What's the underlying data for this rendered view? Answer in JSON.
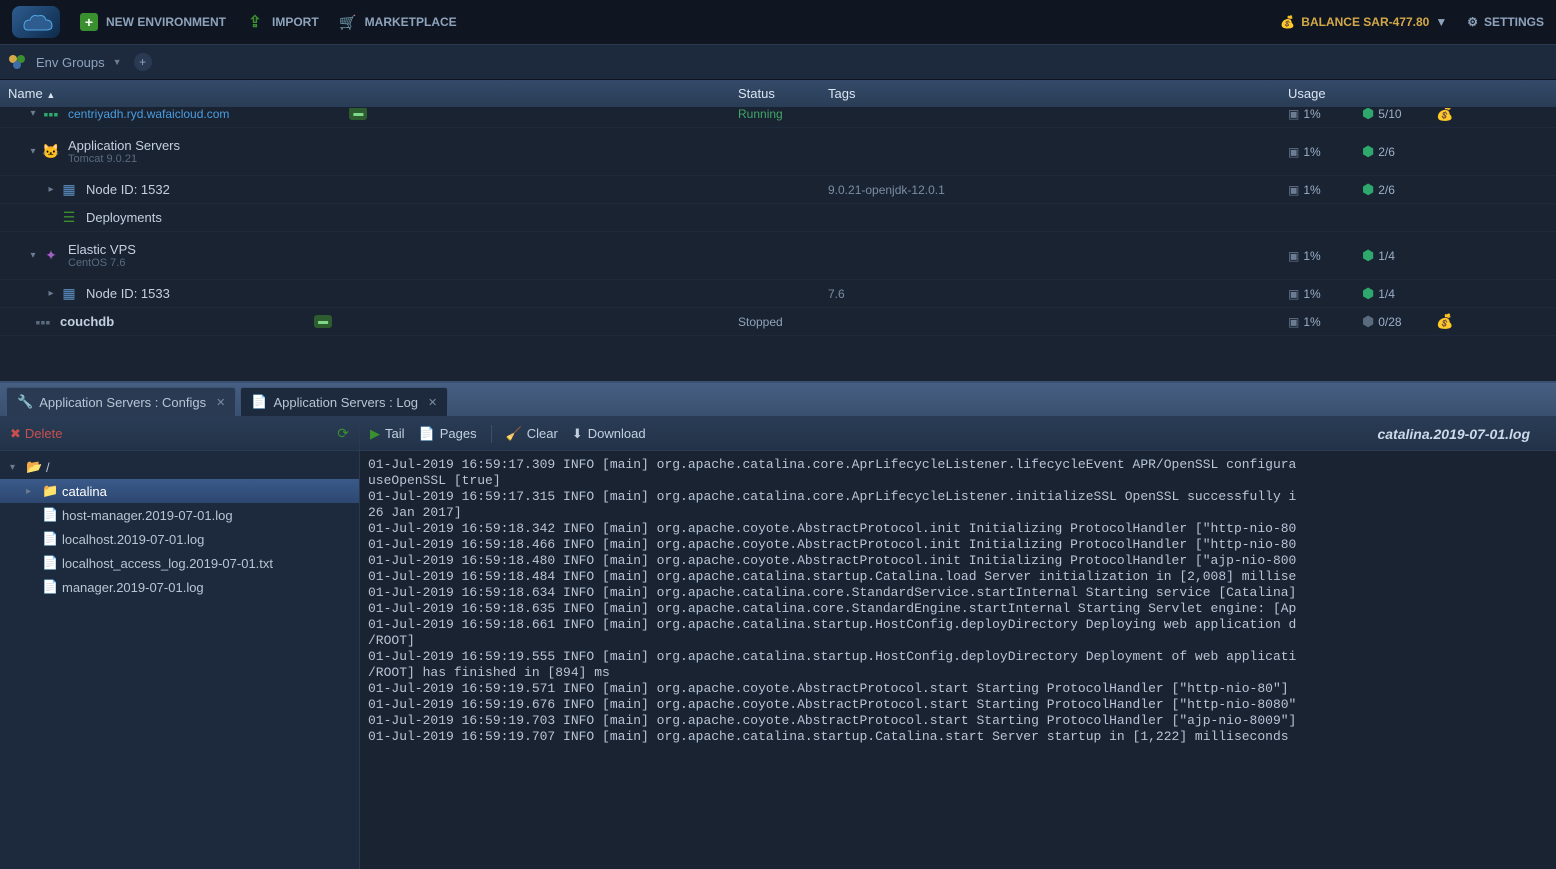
{
  "topbar": {
    "new_env": "NEW ENVIRONMENT",
    "import": "IMPORT",
    "marketplace": "MARKETPLACE",
    "balance": "BALANCE SAR-477.80",
    "settings": "SETTINGS"
  },
  "subbar": {
    "env_groups": "Env Groups"
  },
  "grid": {
    "headers": {
      "name": "Name",
      "status": "Status",
      "tags": "Tags",
      "usage": "Usage"
    },
    "rows": [
      {
        "kind": "env-host",
        "title": "centriyadh.ryd.wafaicloud.com",
        "status": "Running",
        "disk": "1%",
        "cloud": "5/10"
      },
      {
        "kind": "group",
        "title": "Application Servers",
        "sub": "Tomcat 9.0.21",
        "disk": "1%",
        "cloud": "2/6"
      },
      {
        "kind": "node",
        "title": "Node ID: 1532",
        "tags": "9.0.21-openjdk-12.0.1",
        "disk": "1%",
        "cloud": "2/6"
      },
      {
        "kind": "deploy",
        "title": "Deployments"
      },
      {
        "kind": "group",
        "title": "Elastic VPS",
        "sub": "CentOS 7.6",
        "disk": "1%",
        "cloud": "1/4"
      },
      {
        "kind": "node",
        "title": "Node ID: 1533",
        "tags": "7.6",
        "disk": "1%",
        "cloud": "1/4"
      },
      {
        "kind": "env-host",
        "title": "couchdb",
        "status": "Stopped",
        "disk": "1%",
        "cloud": "0/28"
      }
    ]
  },
  "tabs": {
    "configs": "Application Servers : Configs",
    "log": "Application Servers : Log"
  },
  "filepane": {
    "delete": "Delete",
    "root": "/",
    "items": [
      {
        "name": "catalina",
        "type": "folder",
        "selected": true
      },
      {
        "name": "host-manager.2019-07-01.log",
        "type": "file"
      },
      {
        "name": "localhost.2019-07-01.log",
        "type": "file"
      },
      {
        "name": "localhost_access_log.2019-07-01.txt",
        "type": "file"
      },
      {
        "name": "manager.2019-07-01.log",
        "type": "file"
      }
    ]
  },
  "logtoolbar": {
    "tail": "Tail",
    "pages": "Pages",
    "clear": "Clear",
    "download": "Download",
    "title": "catalina.2019-07-01.log"
  },
  "logcontent": "01-Jul-2019 16:59:17.309 INFO [main] org.apache.catalina.core.AprLifecycleListener.lifecycleEvent APR/OpenSSL configura\nuseOpenSSL [true]\n01-Jul-2019 16:59:17.315 INFO [main] org.apache.catalina.core.AprLifecycleListener.initializeSSL OpenSSL successfully i\n26 Jan 2017]\n01-Jul-2019 16:59:18.342 INFO [main] org.apache.coyote.AbstractProtocol.init Initializing ProtocolHandler [\"http-nio-80\n01-Jul-2019 16:59:18.466 INFO [main] org.apache.coyote.AbstractProtocol.init Initializing ProtocolHandler [\"http-nio-80\n01-Jul-2019 16:59:18.480 INFO [main] org.apache.coyote.AbstractProtocol.init Initializing ProtocolHandler [\"ajp-nio-800\n01-Jul-2019 16:59:18.484 INFO [main] org.apache.catalina.startup.Catalina.load Server initialization in [2,008] millise\n01-Jul-2019 16:59:18.634 INFO [main] org.apache.catalina.core.StandardService.startInternal Starting service [Catalina]\n01-Jul-2019 16:59:18.635 INFO [main] org.apache.catalina.core.StandardEngine.startInternal Starting Servlet engine: [Ap\n01-Jul-2019 16:59:18.661 INFO [main] org.apache.catalina.startup.HostConfig.deployDirectory Deploying web application d\n/ROOT]\n01-Jul-2019 16:59:19.555 INFO [main] org.apache.catalina.startup.HostConfig.deployDirectory Deployment of web applicati\n/ROOT] has finished in [894] ms\n01-Jul-2019 16:59:19.571 INFO [main] org.apache.coyote.AbstractProtocol.start Starting ProtocolHandler [\"http-nio-80\"]\n01-Jul-2019 16:59:19.676 INFO [main] org.apache.coyote.AbstractProtocol.start Starting ProtocolHandler [\"http-nio-8080\"\n01-Jul-2019 16:59:19.703 INFO [main] org.apache.coyote.AbstractProtocol.start Starting ProtocolHandler [\"ajp-nio-8009\"]\n01-Jul-2019 16:59:19.707 INFO [main] org.apache.catalina.startup.Catalina.start Server startup in [1,222] milliseconds"
}
